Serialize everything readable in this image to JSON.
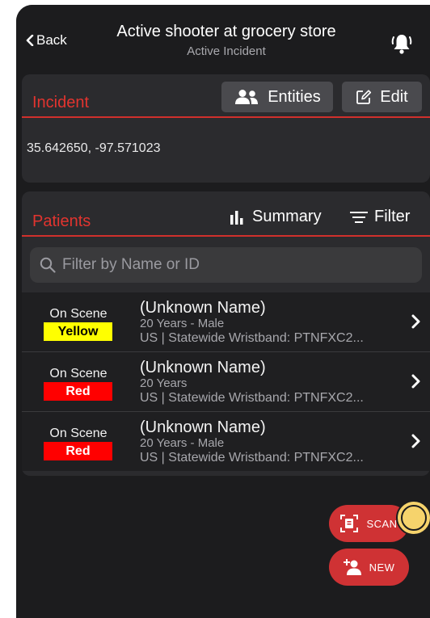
{
  "nav": {
    "back_label": "Back",
    "title": "Active shooter at grocery store",
    "subtitle": "Active Incident",
    "bell_icon": "bell-ringing-icon"
  },
  "incident": {
    "title": "Incident",
    "entities_label": "Entities",
    "edit_label": "Edit",
    "coordinates": "35.642650, -97.571023"
  },
  "patients": {
    "title": "Patients",
    "summary_label": "Summary",
    "filter_label": "Filter",
    "search_placeholder": "Filter by Name or ID",
    "rows": [
      {
        "status": "On Scene",
        "triage": "Yellow",
        "name": "(Unknown Name)",
        "detail": "20 Years - Male",
        "wristband": "US | Statewide Wristband: PTNFXC2..."
      },
      {
        "status": "On Scene",
        "triage": "Red",
        "name": "(Unknown Name)",
        "detail": "20 Years",
        "wristband": "US | Statewide Wristband: PTNFXC2..."
      },
      {
        "status": "On Scene",
        "triage": "Red",
        "name": "(Unknown Name)",
        "detail": "20 Years - Male",
        "wristband": "US | Statewide Wristband: PTNFXC2..."
      }
    ]
  },
  "actions": {
    "scan_label": "SCAN",
    "new_label": "NEW"
  },
  "colors": {
    "accent_red": "#e2342f",
    "triage_yellow": "#ffff00",
    "triage_red": "#ff0000",
    "fab_red": "#cf3234"
  }
}
